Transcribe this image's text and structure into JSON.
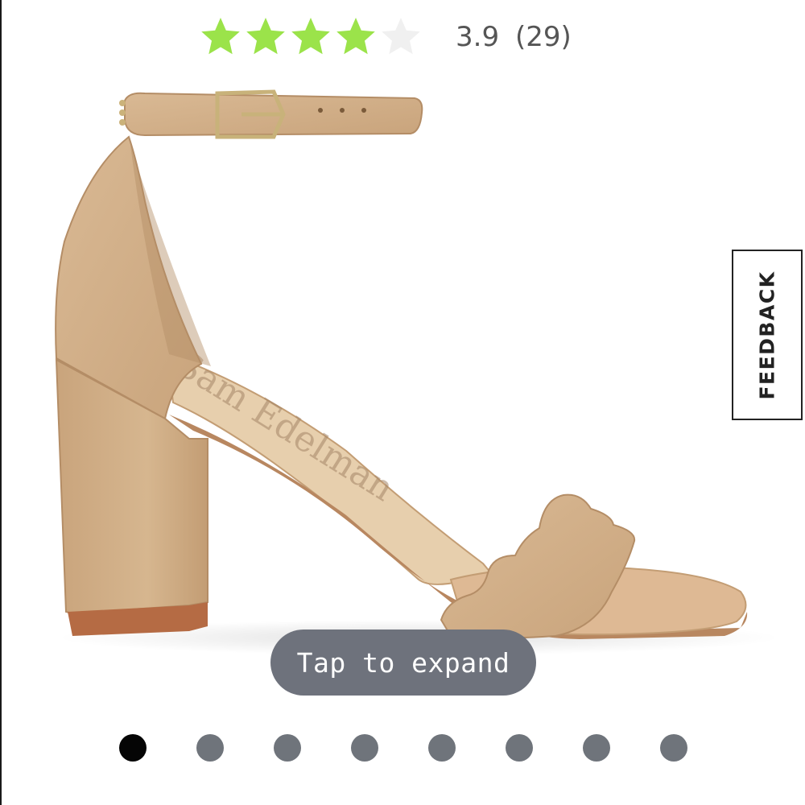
{
  "rating": {
    "value": "3.9",
    "count": "(29)",
    "stars_total": 5,
    "stars_filled": 4,
    "filled_color": "#9be34a",
    "empty_color": "#f0f0f0"
  },
  "product": {
    "sole_logo_text": "Sam Edelman"
  },
  "feedback": {
    "label": "FEEDBACK"
  },
  "expand": {
    "label": "Tap to expand"
  },
  "carousel": {
    "dots": [
      {
        "active": true
      },
      {
        "active": false
      },
      {
        "active": false
      },
      {
        "active": false
      },
      {
        "active": false
      },
      {
        "active": false
      },
      {
        "active": false
      },
      {
        "active": false
      }
    ],
    "active_color": "#050505",
    "inactive_color": "#6f747b"
  }
}
